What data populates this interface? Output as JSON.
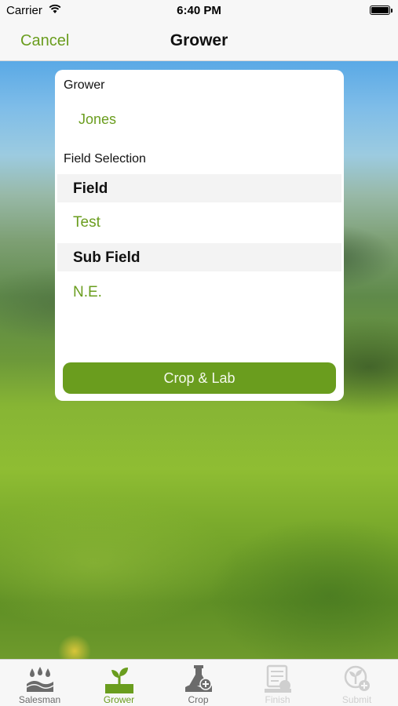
{
  "status_bar": {
    "carrier": "Carrier",
    "time": "6:40 PM",
    "wifi_icon": "wifi-icon",
    "battery_icon": "battery-icon"
  },
  "nav": {
    "cancel_label": "Cancel",
    "title": "Grower"
  },
  "form": {
    "grower_label": "Grower",
    "grower_value": "Jones",
    "field_selection_label": "Field Selection",
    "field_header": "Field",
    "field_value": "Test",
    "sub_field_header": "Sub Field",
    "sub_field_value": "N.E.",
    "next_button_label": "Crop & Lab"
  },
  "tabs": [
    {
      "label": "Salesman",
      "icon": "salesman-icon",
      "state": "inactive"
    },
    {
      "label": "Grower",
      "icon": "grower-icon",
      "state": "active"
    },
    {
      "label": "Crop",
      "icon": "crop-icon",
      "state": "inactive"
    },
    {
      "label": "Finish",
      "icon": "finish-icon",
      "state": "disabled"
    },
    {
      "label": "Submit",
      "icon": "submit-icon",
      "state": "disabled"
    }
  ],
  "colors": {
    "accent": "#6a9d1e",
    "bar_background": "#f7f7f7",
    "disabled": "#cfcfcf"
  }
}
